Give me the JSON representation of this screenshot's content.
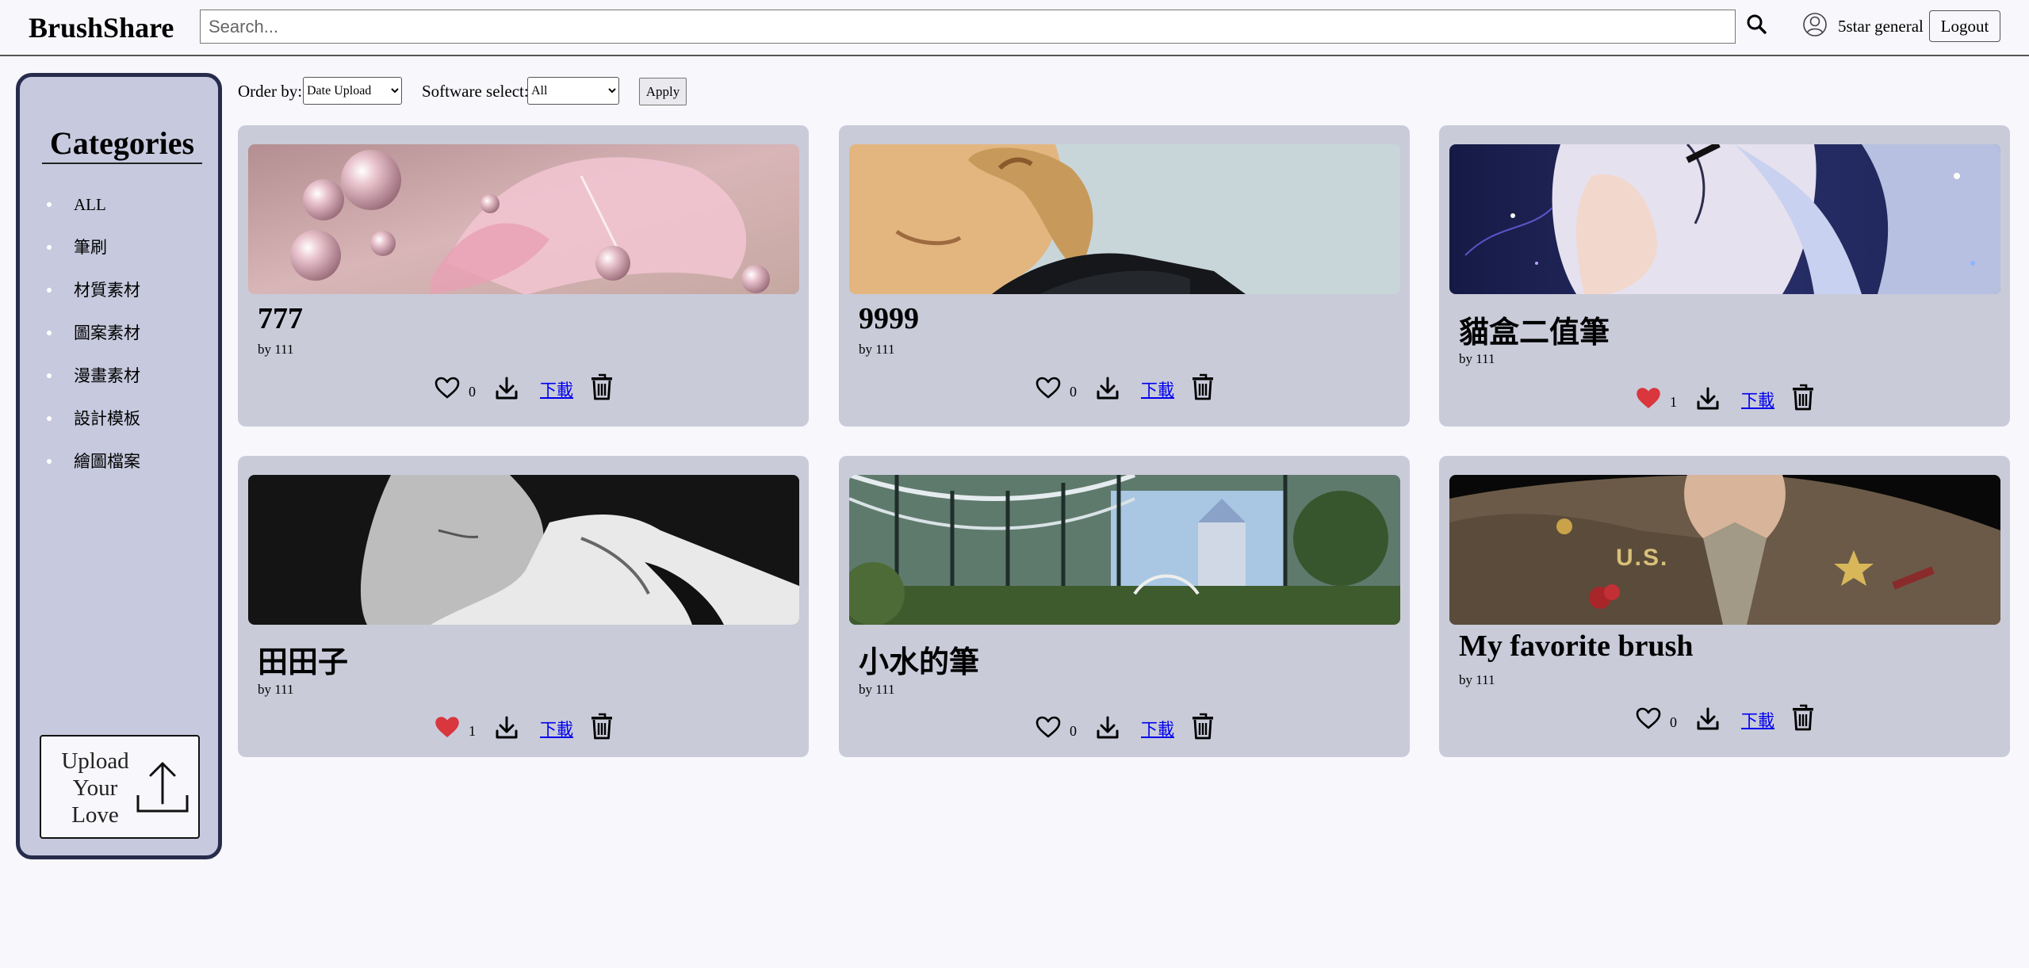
{
  "header": {
    "logo": "BrushShare",
    "search_placeholder": "Search...",
    "username": "5star general",
    "logout_label": "Logout"
  },
  "sidebar": {
    "title": "Categories",
    "items": [
      {
        "label": "ALL"
      },
      {
        "label": "筆刷"
      },
      {
        "label": "材質素材"
      },
      {
        "label": "圖案素材"
      },
      {
        "label": "漫畫素材"
      },
      {
        "label": "設計模板"
      },
      {
        "label": "繪圖檔案"
      }
    ],
    "upload_label": "Upload Your Love"
  },
  "filters": {
    "order_label": "Order by:",
    "order_value": "Date Upload",
    "software_label": "Software select:",
    "software_value": "All",
    "apply_label": "Apply"
  },
  "cards": [
    {
      "title": "777",
      "author": "by 111",
      "likes": "0",
      "liked": false,
      "download_label": "下載",
      "image_icon": "pink-butterfly-bubbles-image"
    },
    {
      "title": "9999",
      "author": "by 111",
      "likes": "0",
      "liked": false,
      "download_label": "下載",
      "image_icon": "man-profile-image"
    },
    {
      "title": "貓盒二值筆",
      "author": "by 111",
      "likes": "1",
      "liked": true,
      "download_label": "下載",
      "image_icon": "anime-girl-image"
    },
    {
      "title": "田田子",
      "author": "by 111",
      "likes": "1",
      "liked": true,
      "download_label": "下載",
      "image_icon": "monochrome-portrait-image"
    },
    {
      "title": "小水的筆",
      "author": "by 111",
      "likes": "0",
      "liked": false,
      "download_label": "下載",
      "image_icon": "greenhouse-image"
    },
    {
      "title": "My favorite brush",
      "author": "by 111",
      "likes": "0",
      "liked": false,
      "download_label": "下載",
      "image_icon": "us-uniform-image"
    }
  ],
  "colors": {
    "page_bg": "#f7f7fc",
    "sidebar_bg": "#c7cade",
    "sidebar_border": "#272c4c",
    "card_bg": "#c9cbd9",
    "liked_heart": "#d9363e",
    "link": "#0000ee"
  }
}
